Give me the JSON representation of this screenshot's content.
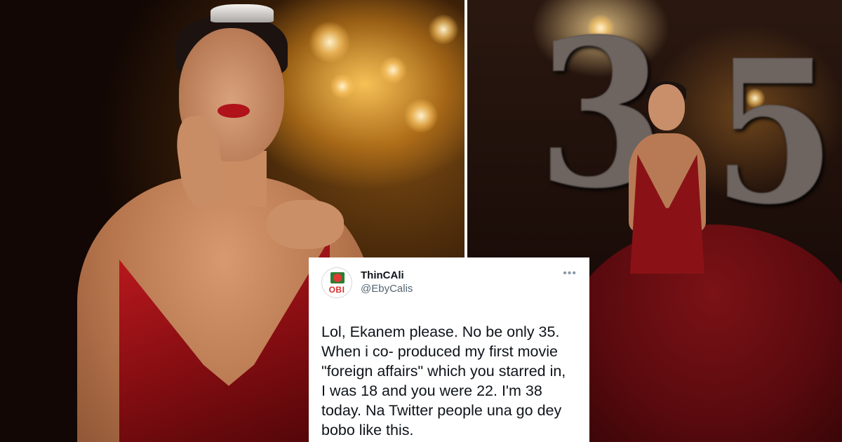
{
  "tweet": {
    "display_name": "ThinCAli",
    "handle": "@EbyCalis",
    "avatar_text": "OBI",
    "more_icon": "more-options-icon",
    "body": "Lol, Ekanem please. No be only 35.\nWhen i co- produced my first movie\n\"foreign affairs\" which you starred in,\nI was 18 and you were 22. I'm 38\ntoday. Na Twitter people una go dey\nbobo like this."
  },
  "balloons": {
    "digit_1": "3",
    "digit_2": "5"
  },
  "colors": {
    "dress_red": "#b0131a",
    "card_background": "#ffffff",
    "handle_grey": "#536471"
  }
}
